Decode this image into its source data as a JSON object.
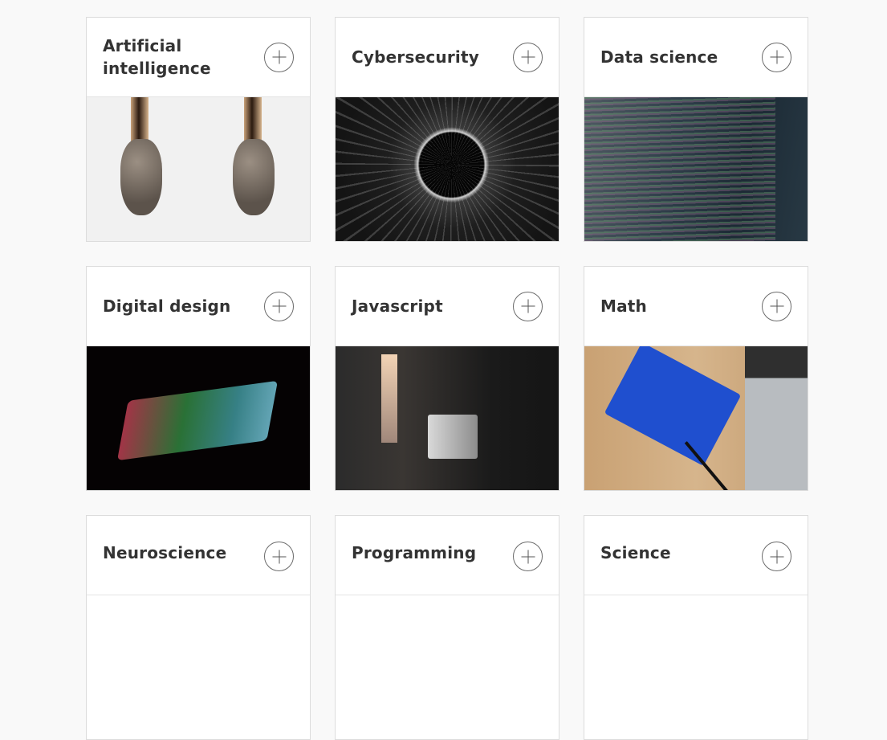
{
  "topics": [
    {
      "id": "ai",
      "title": "Artificial intelligence"
    },
    {
      "id": "cyber",
      "title": "Cybersecurity"
    },
    {
      "id": "data",
      "title": "Data science"
    },
    {
      "id": "design",
      "title": "Digital design"
    },
    {
      "id": "js",
      "title": "Javascript"
    },
    {
      "id": "math",
      "title": "Math"
    },
    {
      "id": "neuro",
      "title": "Neuroscience"
    },
    {
      "id": "prog",
      "title": "Programming"
    },
    {
      "id": "sci",
      "title": "Science"
    }
  ],
  "icons": {
    "expand": "plus-circle-icon"
  },
  "colors": {
    "card_border": "#dcdcdc",
    "title": "#333333",
    "page_bg": "#f9f9f9"
  }
}
